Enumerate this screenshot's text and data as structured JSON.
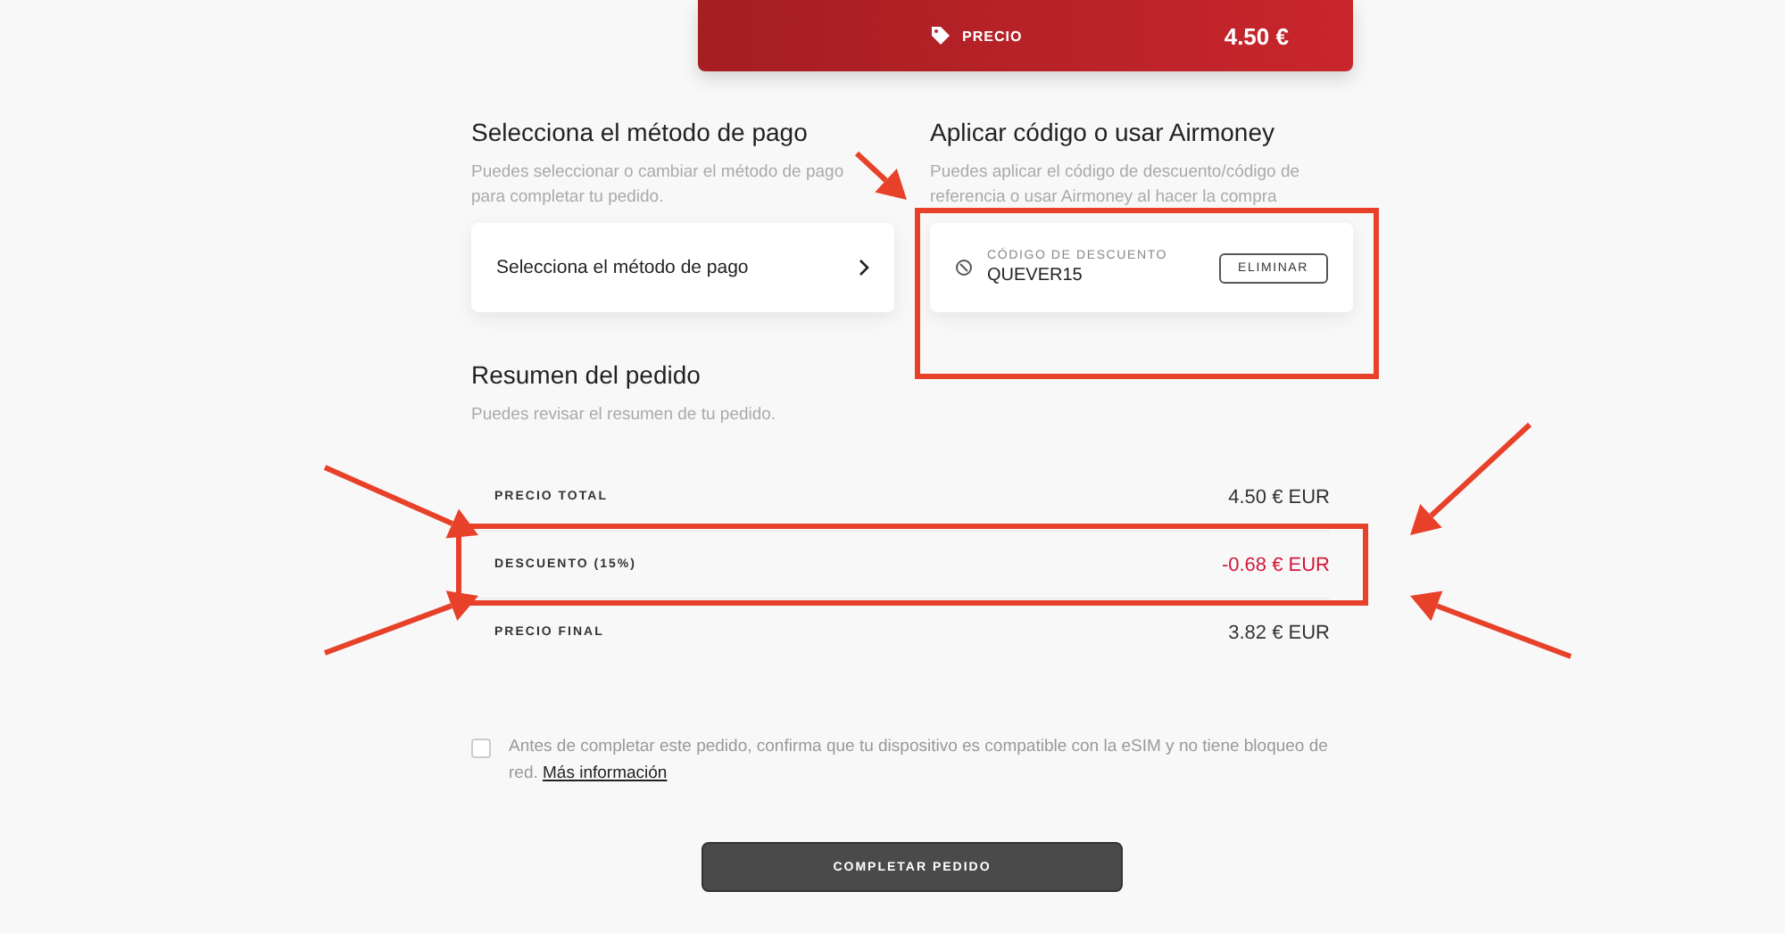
{
  "price_card": {
    "label": "PRECIO",
    "amount": "4.50 €"
  },
  "payment": {
    "title": "Selecciona el método de pago",
    "description": "Puedes seleccionar o cambiar el método de pago para completar tu pedido.",
    "button": "Selecciona el método de pago"
  },
  "code": {
    "title": "Aplicar código o usar Airmoney",
    "description": "Puedes aplicar el código de descuento/código de referencia o usar Airmoney al hacer la compra",
    "label": "CÓDIGO DE DESCUENTO",
    "value": "QUEVER15",
    "remove": "ELIMINAR"
  },
  "summary": {
    "title": "Resumen del pedido",
    "description": "Puedes revisar el resumen de tu pedido.",
    "rows": [
      {
        "label": "PRECIO TOTAL",
        "value": "4.50 € EUR",
        "kind": "normal"
      },
      {
        "label": "DESCUENTO (15%)",
        "value": "-0.68 € EUR",
        "kind": "discount"
      },
      {
        "label": "PRECIO FINAL",
        "value": "3.82 € EUR",
        "kind": "normal"
      }
    ]
  },
  "consent": {
    "checked": false,
    "text": "Antes de completar este pedido, confirma que tu dispositivo es compatible con la eSIM y no tiene bloqueo de red.",
    "link": "Más información"
  },
  "submit": "COMPLETAR PEDIDO"
}
